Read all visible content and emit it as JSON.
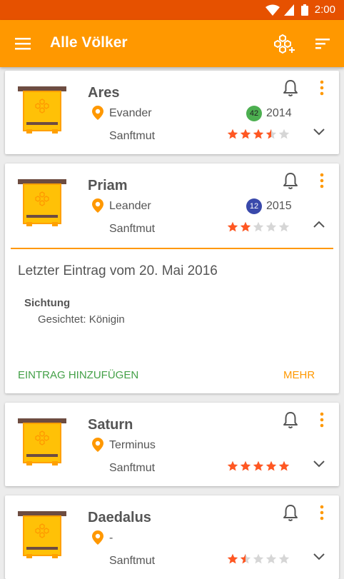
{
  "status_bar": {
    "time": "2:00"
  },
  "app_bar": {
    "title": "Alle Völker"
  },
  "colors": {
    "primary": "#ff9800",
    "status_bar": "#e65100",
    "star": "#ff5722",
    "badge_green": "#4caf50",
    "badge_blue": "#3949ab",
    "add_action": "#43a047"
  },
  "colonies": [
    {
      "name": "Ares",
      "location": "Evander",
      "badge": "42",
      "badge_color": "green",
      "year": "2014",
      "trait": "Sanftmut",
      "rating": 3.5,
      "expanded": false
    },
    {
      "name": "Priam",
      "location": "Leander",
      "badge": "12",
      "badge_color": "blue",
      "year": "2015",
      "trait": "Sanftmut",
      "rating": 2,
      "expanded": true,
      "details": {
        "last_entry": "Letzter Eintrag vom 20. Mai 2016",
        "section_label": "Sichtung",
        "section_value": "Gesichtet: Königin",
        "add_label": "EINTRAG HINZUFÜGEN",
        "more_label": "MEHR"
      }
    },
    {
      "name": "Saturn",
      "location": "Terminus",
      "trait": "Sanftmut",
      "rating": 5,
      "expanded": false
    },
    {
      "name": "Daedalus",
      "location": "-",
      "trait": "Sanftmut",
      "rating": 1.5,
      "expanded": false
    }
  ]
}
